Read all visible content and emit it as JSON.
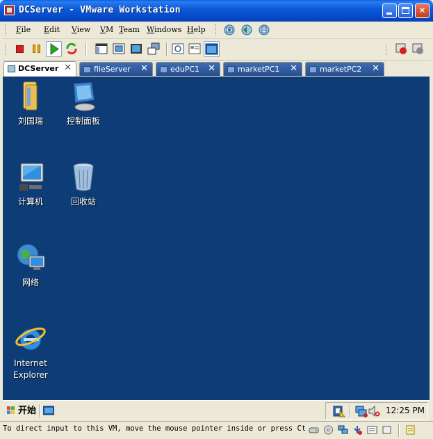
{
  "window": {
    "title": "DCServer - VMware Workstation",
    "controls": [
      "minimize",
      "maximize",
      "close"
    ]
  },
  "menu": {
    "items": [
      "File",
      "Edit",
      "View",
      "VM",
      "Team",
      "Windows",
      "Help"
    ]
  },
  "toolbar": {
    "icons": [
      "power-off-icon",
      "pause-icon",
      "play-icon",
      "reset-icon",
      "sidebar-view-icon",
      "quick-switch-icon",
      "fullscreen-icon",
      "unity-icon",
      "snapshot-icon",
      "revert-snapshot-icon",
      "snapshot-manager-icon",
      "console-view-icon",
      "summary-view-icon"
    ]
  },
  "tabs": [
    {
      "label": "DCServer",
      "active": true
    },
    {
      "label": "fileServer",
      "active": false
    },
    {
      "label": "eduPC1",
      "active": false
    },
    {
      "label": "marketPC1",
      "active": false
    },
    {
      "label": "marketPC2",
      "active": false
    }
  ],
  "desktop": {
    "background": "#0e3c77",
    "icons": [
      {
        "label": "刘国瑞",
        "icon": "user-folder-icon"
      },
      {
        "label": "控制面板",
        "icon": "control-panel-icon"
      },
      {
        "label": "计算机",
        "icon": "computer-icon"
      },
      {
        "label": "回收站",
        "icon": "recycle-bin-icon"
      },
      {
        "label": "网络",
        "icon": "network-icon"
      },
      {
        "label": "Internet\nExplorer",
        "icon": "internet-explorer-icon"
      }
    ]
  },
  "taskbar": {
    "start_label": "开始",
    "clock": "12:25 PM"
  },
  "status": {
    "text": "To direct input to this VM, move the mouse pointer inside or press Ctrl+G."
  }
}
